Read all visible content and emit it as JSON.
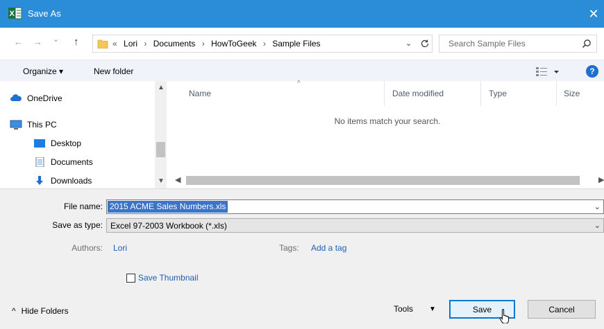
{
  "window": {
    "title": "Save As",
    "close": "✕",
    "app_icon": "excel-icon"
  },
  "nav": {
    "back": "←",
    "forward": "→",
    "recent": "⌄",
    "up": "↑",
    "breadcrumb_lead": "«",
    "breadcrumbs": [
      "Lori",
      "Documents",
      "HowToGeek",
      "Sample Files"
    ],
    "sep": "›"
  },
  "search": {
    "placeholder": "Search Sample Files"
  },
  "toolbar": {
    "organize": "Organize ▾",
    "new_folder": "New folder",
    "help": "?"
  },
  "sidebar": {
    "items": [
      {
        "label": "OneDrive",
        "icon": "cloud-icon"
      },
      {
        "label": "This PC",
        "icon": "computer-icon"
      },
      {
        "label": "Desktop",
        "icon": "desktop-icon"
      },
      {
        "label": "Documents",
        "icon": "documents-icon"
      },
      {
        "label": "Downloads",
        "icon": "downloads-icon"
      }
    ]
  },
  "filelist": {
    "columns": [
      "Name",
      "Date modified",
      "Type",
      "Size"
    ],
    "empty_message": "No items match your search."
  },
  "form": {
    "file_name_label": "File name:",
    "file_name_value": "2015 ACME Sales Numbers.xls",
    "save_type_label": "Save as type:",
    "save_type_value": "Excel 97-2003 Workbook (*.xls)",
    "authors_label": "Authors:",
    "authors_value": "Lori",
    "tags_label": "Tags:",
    "tags_value": "Add a tag",
    "thumbnail_label": "Save Thumbnail"
  },
  "footer": {
    "hide_folders": "Hide Folders",
    "tools": "Tools",
    "save": "Save",
    "cancel": "Cancel"
  },
  "colors": {
    "titlebar": "#2b8cd8",
    "selection": "#3a73c7",
    "link": "#1a5fb4",
    "accent": "#0078d7"
  }
}
